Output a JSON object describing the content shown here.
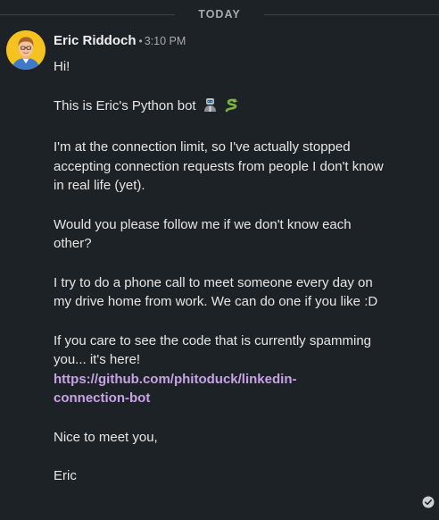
{
  "divider": {
    "label": "TODAY"
  },
  "message": {
    "sender": "Eric Riddoch",
    "separator": "•",
    "time": "3:10 PM",
    "greeting": "Hi!",
    "intro": "This is Eric's Python bot",
    "intro_emoji": [
      "robot-person-icon",
      "snake-icon"
    ],
    "limit_text": "I'm at the connection limit, so I've actually stopped accepting connection requests from people I don't know in real life (yet).",
    "follow_text": "Would you please follow me if we don't know each other?",
    "call_text": "I try to do a phone call to meet someone every day on my drive home from work. We can do one if you like :D",
    "code_text": "If you care to see the code that is currently spamming you... it's here!",
    "link_line1": "https://github.com/phitoduck/linkedin-",
    "link_line2": "connection-bot",
    "closing": "Nice to meet you,",
    "signature": "Eric"
  },
  "read_receipt_icon": "check-circle-icon"
}
